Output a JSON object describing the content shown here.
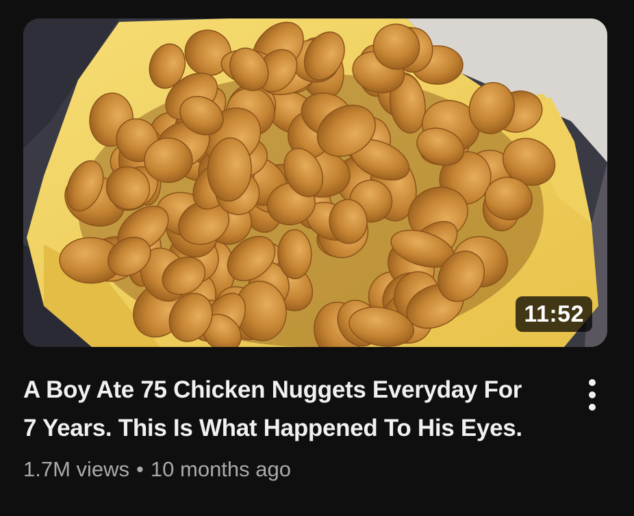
{
  "video": {
    "thumbnail_icon": "chicken-nuggets-photo",
    "duration": "11:52",
    "title_lines": [
      "A Boy Ate 75 Chicken Nuggets Everyday For",
      "7 Years. This Is What Happened To His Eyes."
    ],
    "views": "1.7M views",
    "separator": "•",
    "age": "10 months ago",
    "menu_icon": "more-vert-icon"
  },
  "colors": {
    "background": "#0f0f0f",
    "title": "#f1f1f1",
    "meta": "#aaaaaa",
    "nugget": "#c98e3c",
    "paper": "#f2d35a"
  }
}
